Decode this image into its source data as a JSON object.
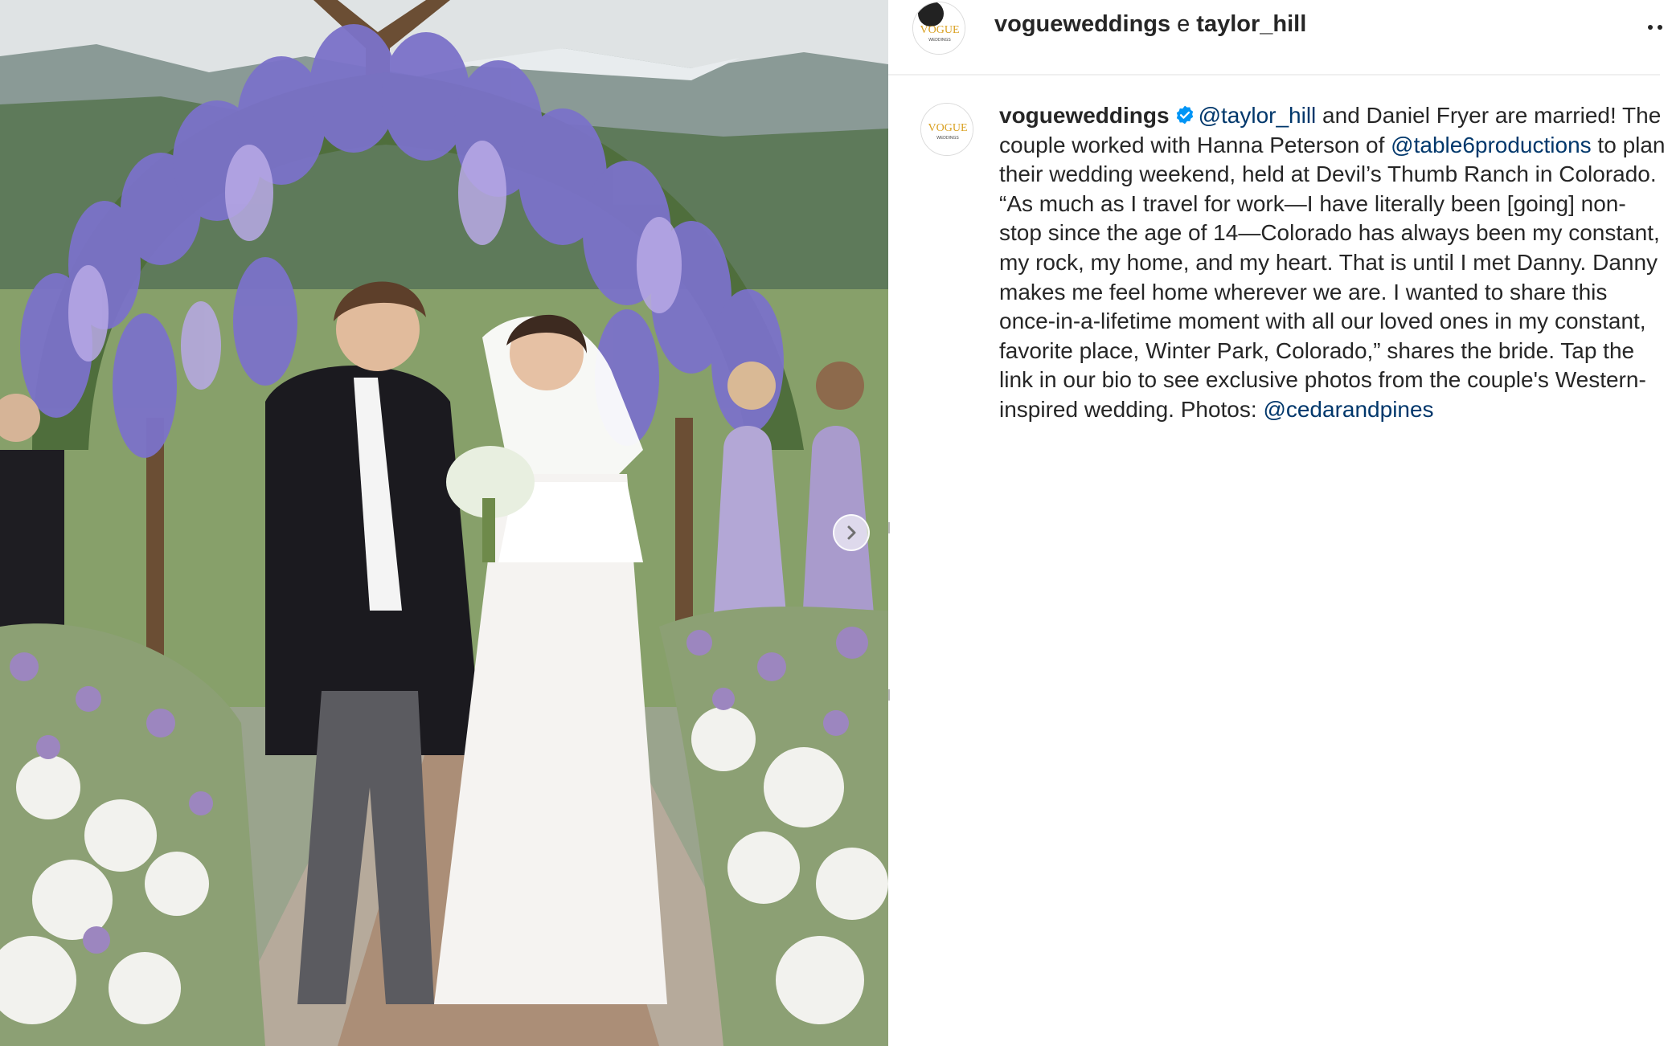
{
  "header": {
    "account": "vogueweddings",
    "separator": "e",
    "collaborator": "taylor_hill",
    "more_icon": "more-horizontal-icon"
  },
  "avatar": {
    "logo_text": "VOGUE",
    "logo_subtext": "WEDDINGS"
  },
  "post": {
    "image_description_icon": "photo",
    "next_icon": "chevron-right-icon"
  },
  "caption": {
    "username": "vogueweddings",
    "verified_icon": "verified-badge-icon",
    "segments": [
      {
        "text": "@taylor_hill",
        "mention": true
      },
      {
        "text": " and Daniel Fryer are married! The couple worked with Hanna Peterson of ",
        "mention": false
      },
      {
        "text": "@table6productions",
        "mention": true
      },
      {
        "text": " to plan their wedding weekend, held at Devil’s Thumb Ranch in Colorado. “As much as I travel for work—I have literally been [going] non-stop since the age of 14—Colorado has always been my constant, my rock, my home, and my heart. That is until I met Danny. Danny makes me feel home wherever we are. I wanted to share this once-in-a-lifetime moment with all our loved ones in my constant, favorite place, Winter Park, Colorado,” shares the bride. Tap the link in our bio to see exclusive photos from the couple's Western-inspired wedding. Photos: ",
        "mention": false
      },
      {
        "text": "@cedarandpines",
        "mention": true
      }
    ]
  },
  "colors": {
    "text": "#262626",
    "mention": "#00376b",
    "verified": "#0095f6",
    "divider": "#efefef"
  }
}
